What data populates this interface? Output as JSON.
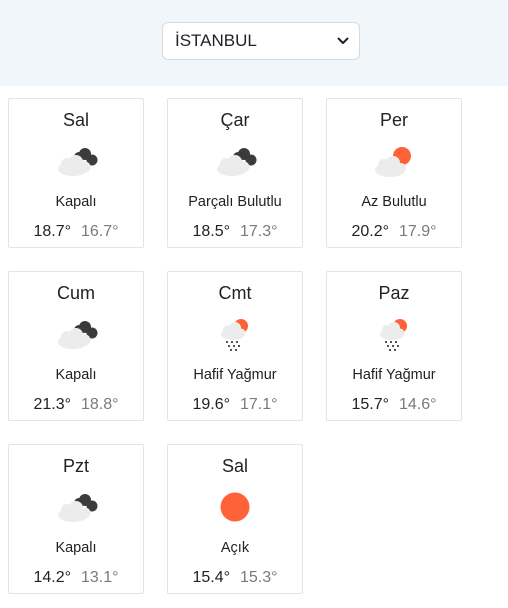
{
  "city_select": {
    "value": "İSTANBUL"
  },
  "forecast": [
    {
      "day": "Sal",
      "condition": "Kapalı",
      "high": "18.7°",
      "low": "16.7°",
      "icon": "cloud-overcast-icon"
    },
    {
      "day": "Çar",
      "condition": "Parçalı Bulutlu",
      "high": "18.5°",
      "low": "17.3°",
      "icon": "cloud-overcast-icon"
    },
    {
      "day": "Per",
      "condition": "Az Bulutlu",
      "high": "20.2°",
      "low": "17.9°",
      "icon": "partly-cloudy-icon"
    },
    {
      "day": "Cum",
      "condition": "Kapalı",
      "high": "21.3°",
      "low": "18.8°",
      "icon": "cloud-overcast-icon"
    },
    {
      "day": "Cmt",
      "condition": "Hafif Yağmur",
      "high": "19.6°",
      "low": "17.1°",
      "icon": "light-rain-icon"
    },
    {
      "day": "Paz",
      "condition": "Hafif Yağmur",
      "high": "15.7°",
      "low": "14.6°",
      "icon": "light-rain-icon"
    },
    {
      "day": "Pzt",
      "condition": "Kapalı",
      "high": "14.2°",
      "low": "13.1°",
      "icon": "cloud-overcast-icon"
    },
    {
      "day": "Sal",
      "condition": "Açık",
      "high": "15.4°",
      "low": "15.3°",
      "icon": "sun-icon"
    }
  ],
  "colors": {
    "sun": "#ff6138",
    "cloud_light": "#ececec",
    "cloud_dark": "#3b3b3b"
  }
}
